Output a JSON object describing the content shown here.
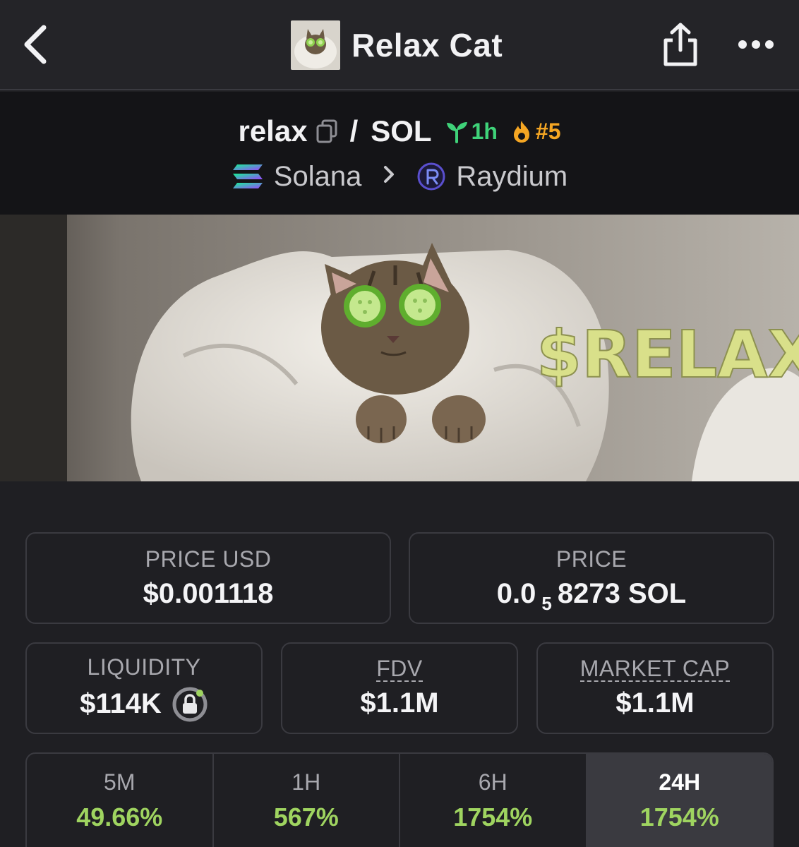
{
  "header": {
    "title": "Relax Cat"
  },
  "pair": {
    "base": "relax",
    "quote": "SOL",
    "age": "1h",
    "rank": "#5",
    "chain": "Solana",
    "dex": "Raydium"
  },
  "banner": {
    "text": "$RELAX"
  },
  "stats": {
    "price_usd_label": "PRICE USD",
    "price_usd": "$0.001118",
    "price_label": "PRICE",
    "price_prefix": "0.0",
    "price_sub": "5",
    "price_suffix": "8273 SOL",
    "liquidity_label": "LIQUIDITY",
    "liquidity": "$114K",
    "fdv_label": "FDV",
    "fdv": "$1.1M",
    "mcap_label": "MARKET CAP",
    "mcap": "$1.1M"
  },
  "timeframes": [
    {
      "label": "5M",
      "value": "49.66%"
    },
    {
      "label": "1H",
      "value": "567%"
    },
    {
      "label": "6H",
      "value": "1754%"
    },
    {
      "label": "24H",
      "value": "1754%",
      "active": true
    }
  ],
  "colors": {
    "positive": "#9fd460",
    "age_badge": "#3fd279",
    "rank_badge": "#f5a623",
    "background": "#1f1f23"
  }
}
